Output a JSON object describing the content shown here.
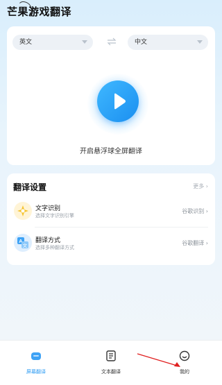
{
  "app": {
    "title": "芒果游戏翻译"
  },
  "language": {
    "source": "英文",
    "target": "中文"
  },
  "floating": {
    "label": "开启悬浮球全屏翻译"
  },
  "settings": {
    "title": "翻译设置",
    "more": "更多 ›",
    "items": [
      {
        "title": "文字识别",
        "subtitle": "选择文字识别引擎",
        "value": "谷歌识别 ›"
      },
      {
        "title": "翻译方式",
        "subtitle": "选择多种翻译方式",
        "value": "谷歌翻译 ›"
      }
    ]
  },
  "tabs": [
    {
      "label": "屏幕翻译",
      "icon": "game-controller-icon",
      "active": true
    },
    {
      "label": "文本翻译",
      "icon": "document-icon",
      "active": false
    },
    {
      "label": "我的",
      "icon": "profile-smile-icon",
      "active": false
    }
  ],
  "colors": {
    "accent": "#2e9cf3",
    "play_gradient_start": "#3fb8ff",
    "play_gradient_end": "#1b8ff0",
    "annotation_arrow": "#e02020"
  }
}
